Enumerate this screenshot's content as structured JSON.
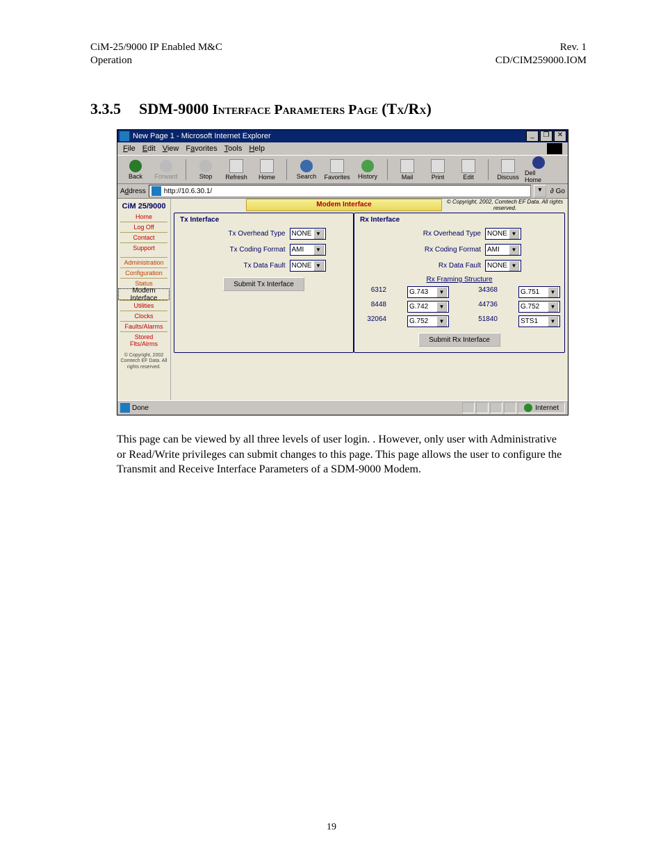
{
  "header": {
    "left1": "CiM-25/9000 IP Enabled M&C",
    "right1": "Rev. 1",
    "left2": "Operation",
    "right2": "CD/CIM259000.IOM"
  },
  "section": {
    "num": "3.3.5",
    "title_a": "SDM-9000 ",
    "title_b": "Interface Parameters Page",
    "title_c": " (T",
    "title_d": "x",
    "title_e": "/R",
    "title_f": "x",
    "title_g": ")"
  },
  "browser": {
    "title": "New Page 1 - Microsoft Internet Explorer",
    "menu": {
      "file": "File",
      "edit": "Edit",
      "view": "View",
      "fav": "Favorites",
      "tools": "Tools",
      "help": "Help"
    },
    "btns": {
      "back": "Back",
      "fwd": "Forward",
      "stop": "Stop",
      "refresh": "Refresh",
      "home": "Home",
      "search": "Search",
      "favs": "Favorites",
      "history": "History",
      "mail": "Mail",
      "print": "Print",
      "editb": "Edit",
      "discuss": "Discuss",
      "dell": "Dell Home"
    },
    "address_lbl": "Address",
    "address_val": "http://10.6.30.1/",
    "go": "Go",
    "status": "Done",
    "zone": "Internet"
  },
  "sidebar": {
    "head": "CiM 25/9000",
    "items": [
      "Home",
      "Log Off",
      "Contact",
      "Support",
      "Administration",
      "Configuration",
      "Status",
      "Modem Interface",
      "Utilities",
      "Clocks",
      "Faults/Alarms",
      "Stored Flts/Alrms"
    ],
    "copy": "© Copyright, 2002\nComtech EF Data.\nAll rights reserved."
  },
  "main": {
    "title": "Modem Interface",
    "copy": "© Copyright, 2002, Comtech EF Data. All rights reserved.",
    "tx": {
      "title": "Tx Interface",
      "l1": "Tx Overhead Type",
      "v1": "NONE",
      "l2": "Tx Coding Format",
      "v2": "AMI",
      "l3": "Tx Data Fault",
      "v3": "NONE",
      "submit": "Submit Tx Interface"
    },
    "rx": {
      "title": "Rx Interface",
      "l1": "Rx Overhead Type",
      "v1": "NONE",
      "l2": "Rx Coding Format",
      "v2": "AMI",
      "l3": "Rx Data Fault",
      "v3": "NONE",
      "fs": "Rx Framing Structure",
      "r1n": "6312",
      "r1v": "G.743",
      "r2n": "8448",
      "r2v": "G.742",
      "r3n": "32064",
      "r3v": "G.752",
      "r4n": "34368",
      "r4v": "G.751",
      "r5n": "44736",
      "r5v": "G.752",
      "r6n": "51840",
      "r6v": "STS1",
      "submit": "Submit Rx Interface"
    }
  },
  "body_text": "This page can be viewed by all three levels of user login.  .  However, only user with Administrative or Read/Write privileges can submit changes to this page.  This page allows the user to configure the Transmit and Receive Interface Parameters of a SDM-9000 Modem.",
  "page_number": "19"
}
